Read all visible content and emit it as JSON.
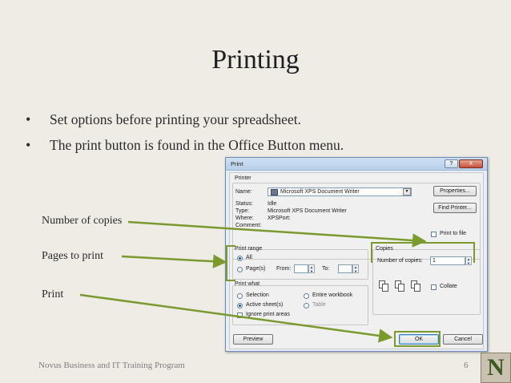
{
  "slide": {
    "title": "Printing",
    "bullets": [
      "Set options before printing your spreadsheet.",
      "The print button is found in the Office Button menu."
    ],
    "callouts": {
      "copies": "Number of copies",
      "pages": "Pages to print",
      "print": "Print"
    },
    "footer": "Novus Business and IT Training Program",
    "page_number": "6",
    "logo_letter": "N",
    "accent_color": "#7a9a2e"
  },
  "dialog": {
    "title": "Print",
    "help_label": "?",
    "close_label": "X",
    "printer": {
      "group_label": "Printer",
      "name_label": "Name:",
      "name_value": "Microsoft XPS Document Writer",
      "status_label": "Status:",
      "status_value": "Idle",
      "type_label": "Type:",
      "type_value": "Microsoft XPS Document Writer",
      "where_label": "Where:",
      "where_value": "XPSPort:",
      "comment_label": "Comment:",
      "properties_button": "Properties...",
      "find_printer_button": "Find Printer...",
      "print_to_file_label": "Print to file"
    },
    "print_range": {
      "group_label": "Print range",
      "all_label": "All",
      "pages_label": "Page(s)",
      "from_label": "From:",
      "to_label": "To:"
    },
    "copies": {
      "group_label": "Copies",
      "number_label": "Number of copies:",
      "number_value": "1",
      "collate_label": "Collate"
    },
    "print_what": {
      "group_label": "Print what",
      "selection_label": "Selection",
      "entire_workbook_label": "Entire workbook",
      "active_sheets_label": "Active sheet(s)",
      "table_label": "Table",
      "ignore_print_areas_label": "Ignore print areas"
    },
    "buttons": {
      "preview": "Preview",
      "ok": "OK",
      "cancel": "Cancel"
    }
  }
}
